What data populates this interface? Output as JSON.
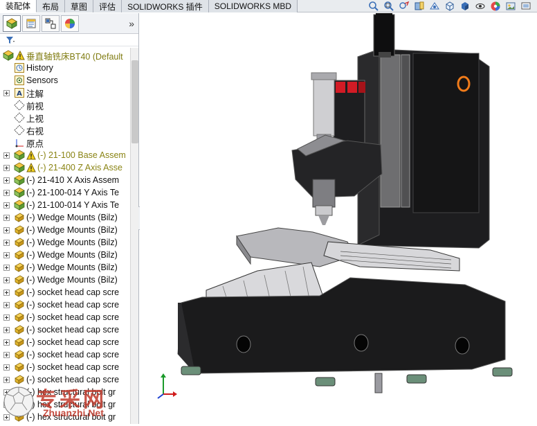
{
  "tabs": [
    {
      "label": "装配体",
      "active": true
    },
    {
      "label": "布局"
    },
    {
      "label": "草图"
    },
    {
      "label": "评估"
    },
    {
      "label": "SOLIDWORKS 插件"
    },
    {
      "label": "SOLIDWORKS MBD"
    }
  ],
  "toolbar_icons": [
    "zoom-to-fit-icon",
    "zoom-area-icon",
    "previous-view-icon",
    "section-view-icon",
    "dynamic-annotation-icon",
    "view-orientation-icon",
    "display-style-icon",
    "hide-show-icon",
    "appearance-icon",
    "scene-icon",
    "view-settings-icon"
  ],
  "feature_manager": {
    "tab_icons": [
      "featuremanager-tree-icon",
      "property-manager-icon",
      "configuration-manager-icon",
      "display-manager-icon"
    ],
    "more": "»",
    "filter_icon": "filter-icon",
    "tree": [
      {
        "label": "垂直轴铣床BT40  (Default",
        "kind": "root",
        "warning": true,
        "icon": "assembly-icon"
      },
      {
        "label": "History",
        "icon": "history-icon"
      },
      {
        "label": "Sensors",
        "icon": "sensor-icon"
      },
      {
        "label": "注解",
        "icon": "annotation-icon",
        "expandable": true
      },
      {
        "label": "前视",
        "icon": "plane-icon"
      },
      {
        "label": "上视",
        "icon": "plane-icon"
      },
      {
        "label": "右视",
        "icon": "plane-icon"
      },
      {
        "label": "原点",
        "icon": "origin-icon"
      },
      {
        "label": "(-) 21-100 Base Assem",
        "icon": "subassembly-icon",
        "warning": true,
        "expandable": true
      },
      {
        "label": "(-) 21-400 Z Axis Asse",
        "icon": "subassembly-icon",
        "warning": true,
        "expandable": true
      },
      {
        "label": "(-) 21-410 X Axis Assem",
        "icon": "subassembly-icon",
        "expandable": true
      },
      {
        "label": "(-) 21-100-014 Y Axis Te",
        "icon": "subassembly-icon",
        "expandable": true
      },
      {
        "label": "(-) 21-100-014 Y Axis Te",
        "icon": "subassembly-icon",
        "expandable": true
      },
      {
        "label": "(-) Wedge Mounts (Bilz)",
        "icon": "part-icon",
        "expandable": true
      },
      {
        "label": "(-) Wedge Mounts (Bilz)",
        "icon": "part-icon",
        "expandable": true
      },
      {
        "label": "(-) Wedge Mounts (Bilz)",
        "icon": "part-icon",
        "expandable": true
      },
      {
        "label": "(-) Wedge Mounts (Bilz)",
        "icon": "part-icon",
        "expandable": true
      },
      {
        "label": "(-) Wedge Mounts (Bilz)",
        "icon": "part-icon",
        "expandable": true
      },
      {
        "label": "(-) Wedge Mounts (Bilz)",
        "icon": "part-icon",
        "expandable": true
      },
      {
        "label": "(-) socket head cap scre",
        "icon": "part-icon",
        "expandable": true
      },
      {
        "label": "(-) socket head cap scre",
        "icon": "part-icon",
        "expandable": true
      },
      {
        "label": "(-) socket head cap scre",
        "icon": "part-icon",
        "expandable": true
      },
      {
        "label": "(-) socket head cap scre",
        "icon": "part-icon",
        "expandable": true
      },
      {
        "label": "(-) socket head cap scre",
        "icon": "part-icon",
        "expandable": true
      },
      {
        "label": "(-) socket head cap scre",
        "icon": "part-icon",
        "expandable": true
      },
      {
        "label": "(-) socket head cap scre",
        "icon": "part-icon",
        "expandable": true
      },
      {
        "label": "(-) socket head cap scre",
        "icon": "part-icon",
        "expandable": true
      },
      {
        "label": "(-) hex structural bolt gr",
        "icon": "part-icon",
        "expandable": true
      },
      {
        "label": "(-) hex structural bolt gr",
        "icon": "part-icon",
        "expandable": true
      },
      {
        "label": "(-) hex structural bolt gr",
        "icon": "part-icon",
        "expandable": true
      }
    ]
  },
  "graphics": {
    "model": "vertical milling machine assembly",
    "triad_icon": "coordinate-triad-icon"
  },
  "watermark": {
    "title": "专采网",
    "url": "Zhuanzhi.Net"
  }
}
